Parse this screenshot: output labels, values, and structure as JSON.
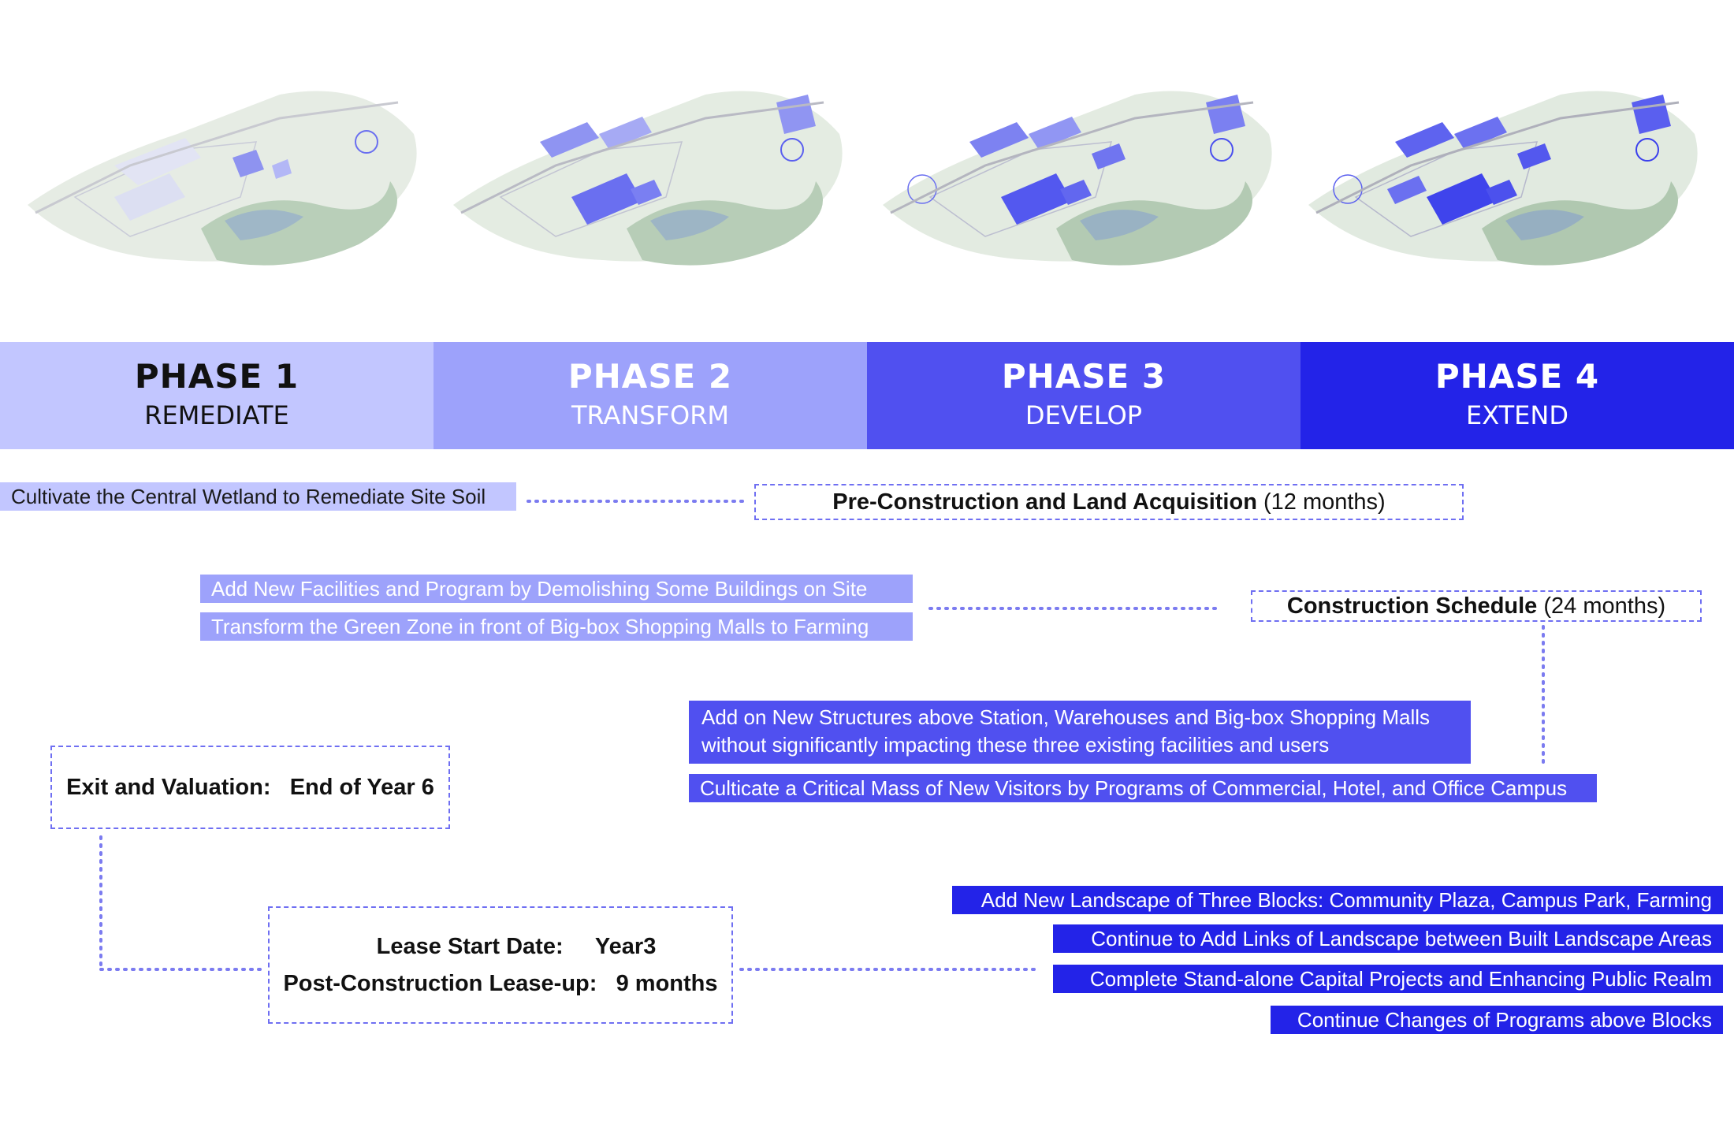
{
  "colors": {
    "phase1": "#c2c6ff",
    "phase2": "#9da2fb",
    "phase3": "#5050f0",
    "phase4": "#2323e8",
    "dotted_line": "#7b7bf0"
  },
  "phases": [
    {
      "number": "PHASE 1",
      "name": "REMEDIATE"
    },
    {
      "number": "PHASE 2",
      "name": "TRANSFORM"
    },
    {
      "number": "PHASE 3",
      "name": "DEVELOP"
    },
    {
      "number": "PHASE 4",
      "name": "EXTEND"
    }
  ],
  "phase1_items": [
    "Cultivate the Central Wetland to Remediate Site Soil"
  ],
  "phase2_items": [
    "Add New Facilities and Program by Demolishing Some Buildings on Site",
    "Transform the Green Zone in front of Big-box Shopping Malls to Farming"
  ],
  "phase3_items": [
    "Add on New Structures above Station, Warehouses and Big-box Shopping Malls",
    "without significantly impacting these three existing facilities and users",
    "Culticate a Critical Mass of New Visitors by Programs of Commercial, Hotel, and Office Campus"
  ],
  "phase4_items": [
    "Add New Landscape of Three Blocks: Community Plaza, Campus Park, Farming",
    "Continue to Add Links of Landscape between Built Landscape Areas",
    "Complete Stand-alone Capital Projects and Enhancing Public Realm",
    "Continue Changes of Programs above Blocks"
  ],
  "milestones": {
    "preconstruction": {
      "label": "Pre-Construction and Land Acquisition",
      "duration": "(12 months)"
    },
    "construction": {
      "label": "Construction Schedule",
      "duration": "(24 months)"
    },
    "exit": {
      "label": "Exit and Valuation:",
      "value": "End of Year 6"
    },
    "lease": {
      "start_label": "Lease Start Date:",
      "start_value": "Year3",
      "leaseup_label": "Post-Construction Lease-up:",
      "leaseup_value": "9 months"
    }
  },
  "plan_images": [
    {
      "name": "phase-1-site-plan",
      "highlight_level": "low"
    },
    {
      "name": "phase-2-site-plan",
      "highlight_level": "medium"
    },
    {
      "name": "phase-3-site-plan",
      "highlight_level": "high"
    },
    {
      "name": "phase-4-site-plan",
      "highlight_level": "full"
    }
  ]
}
